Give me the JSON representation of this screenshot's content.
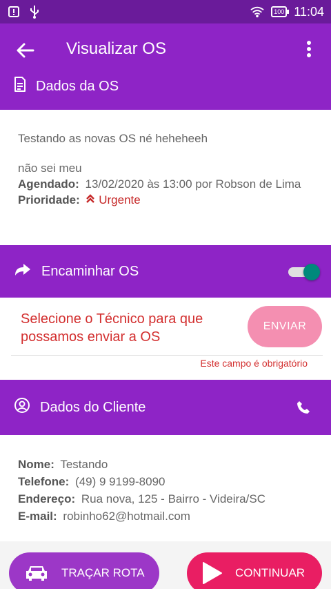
{
  "status_bar": {
    "time": "11:04",
    "battery": "100",
    "icons": [
      "alert-icon",
      "usb-icon",
      "wifi-icon",
      "battery-icon"
    ]
  },
  "app_bar": {
    "title": "Visualizar OS",
    "section_title": "Dados da OS",
    "icons": [
      "back-arrow-icon",
      "more-vert-icon",
      "document-icon"
    ]
  },
  "os": {
    "description": "Testando as novas OS né heheheeh",
    "note": "não sei meu",
    "scheduled_label": "Agendado:",
    "scheduled_value": "13/02/2020 às 13:00 por Robson de Lima",
    "priority_label": "Prioridade:",
    "priority_value": "Urgente",
    "priority_icon": "double-chevron-up-icon",
    "priority_color": "#c62828"
  },
  "forward": {
    "label": "Encaminhar OS",
    "icon": "forward-arrow-icon",
    "toggle_on": true,
    "prompt": "Selecione o Técnico para que possamos enviar a OS",
    "send_button": "ENVIAR",
    "error": "Este campo é obrigatório"
  },
  "client": {
    "section_title": "Dados do Cliente",
    "icons": [
      "user-circle-icon",
      "phone-icon"
    ],
    "name_label": "Nome:",
    "name": "Testando",
    "phone_label": "Telefone:",
    "phone": "(49) 9 9199-8090",
    "address_label": "Endereço:",
    "address": "Rua nova, 125 - Bairro - Videira/SC",
    "email_label": "E-mail:",
    "email": "robinho62@hotmail.com"
  },
  "actions": {
    "route_label": "TRAÇAR ROTA",
    "continue_label": "CONTINUAR",
    "icons": [
      "car-icon",
      "play-icon"
    ]
  },
  "colors": {
    "primary": "#8e24c6",
    "status_bar": "#6a1b9a",
    "accent_pink": "#e91e63",
    "disabled_pink": "#f48fb1",
    "toggle": "#00897b",
    "error": "#d32f2f"
  }
}
